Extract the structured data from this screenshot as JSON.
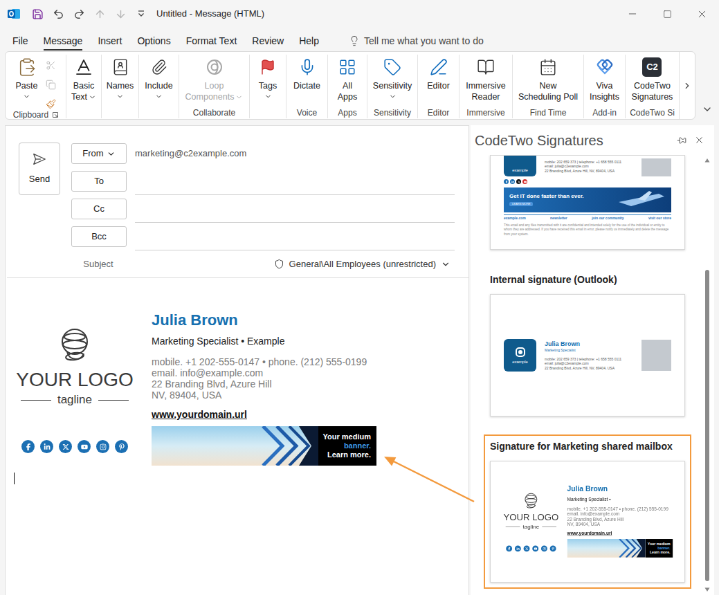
{
  "window": {
    "title": "Untitled - Message (HTML)"
  },
  "quick_access": [
    {
      "disabled": false
    },
    {
      "disabled": false
    },
    {
      "disabled": false
    },
    {
      "disabled": true
    },
    {
      "disabled": true
    },
    {
      "disabled": false
    }
  ],
  "menu": {
    "tabs": [
      {
        "label": "File",
        "selected": false
      },
      {
        "label": "Message",
        "selected": true
      },
      {
        "label": "Insert",
        "selected": false
      },
      {
        "label": "Options",
        "selected": false
      },
      {
        "label": "Format Text",
        "selected": false
      },
      {
        "label": "Review",
        "selected": false
      },
      {
        "label": "Help",
        "selected": false
      }
    ],
    "tell_me": {
      "placeholder": "Tell me what you want to do"
    }
  },
  "ribbon": {
    "groups": [
      {
        "label": "Clipboard",
        "buttons": [
          {
            "lines": [
              "Paste"
            ],
            "dropdown": true,
            "disabled": false
          }
        ],
        "tools": [
          {
            "disabled": true
          },
          {
            "disabled": true
          },
          {
            "disabled": false
          }
        ]
      },
      {
        "buttons": [
          {
            "lines": [
              "Basic",
              "Text"
            ],
            "dropdown": true,
            "disabled": false
          }
        ]
      },
      {
        "buttons": [
          {
            "lines": [
              "Names"
            ],
            "dropdown": true,
            "disabled": false
          }
        ]
      },
      {
        "buttons": [
          {
            "lines": [
              "Include"
            ],
            "dropdown": true,
            "disabled": false
          }
        ]
      },
      {
        "label": "Collaborate",
        "buttons": [
          {
            "lines": [
              "Loop",
              "Components"
            ],
            "dropdown": true,
            "disabled": true
          }
        ]
      },
      {
        "buttons": [
          {
            "lines": [
              "Tags"
            ],
            "dropdown": true,
            "disabled": false
          }
        ]
      },
      {
        "label": "Voice",
        "buttons": [
          {
            "lines": [
              "Dictate"
            ],
            "dropdown": false,
            "disabled": false
          }
        ]
      },
      {
        "label": "Apps",
        "buttons": [
          {
            "lines": [
              "All",
              "Apps"
            ],
            "dropdown": false,
            "disabled": false
          }
        ]
      },
      {
        "label": "Sensitivity",
        "buttons": [
          {
            "lines": [
              "Sensitivity"
            ],
            "dropdown": true,
            "disabled": false
          }
        ]
      },
      {
        "label": "Editor",
        "buttons": [
          {
            "lines": [
              "Editor"
            ],
            "dropdown": false,
            "disabled": false
          }
        ]
      },
      {
        "label": "Immersive",
        "buttons": [
          {
            "lines": [
              "Immersive",
              "Reader"
            ],
            "dropdown": false,
            "disabled": false
          }
        ]
      },
      {
        "label": "Find Time",
        "buttons": [
          {
            "lines": [
              "New",
              "Scheduling Poll"
            ],
            "dropdown": false,
            "disabled": false
          }
        ]
      },
      {
        "label": "Add-in",
        "buttons": [
          {
            "lines": [
              "Viva",
              "Insights"
            ],
            "dropdown": false,
            "disabled": false
          }
        ]
      },
      {
        "label": "CodeTwo Si",
        "buttons": [
          {
            "lines": [
              "CodeTwo",
              "Signatures"
            ],
            "dropdown": false,
            "disabled": false,
            "icon_text": "C2"
          }
        ]
      }
    ]
  },
  "compose": {
    "send": {
      "label": "Send"
    },
    "fields": [
      {
        "kind": "sender",
        "label": "From",
        "dropdown": true,
        "value": "marketing@c2example.com"
      },
      {
        "kind": "recipient",
        "label": "To",
        "dropdown": false,
        "value": ""
      },
      {
        "kind": "recipient",
        "label": "Cc",
        "dropdown": false,
        "value": ""
      },
      {
        "kind": "recipient",
        "label": "Bcc",
        "dropdown": false,
        "value": ""
      }
    ],
    "subject": {
      "label": "Subject",
      "value": ""
    },
    "sensitivity": {
      "label": "General\\All Employees (unrestricted)"
    }
  },
  "signature": {
    "logo": {
      "text": "YOUR LOGO",
      "tagline": "tagline"
    },
    "name": "Julia Brown",
    "title": "Marketing Specialist • Example",
    "contacts": [
      "mobile. +1 202-555-0147 • phone. (212) 555-0199",
      "email. info@example.com",
      "22 Branding Blvd, Azure Hill",
      "NV, 89404, USA"
    ],
    "website": "www.yourdomain.url",
    "banner": [
      {
        "text": "Your medium",
        "accent": false
      },
      {
        "text": "banner.",
        "accent": true
      },
      {
        "text": "Learn more.",
        "accent": false
      }
    ]
  },
  "pane": {
    "title": "CodeTwo Signatures",
    "templates": [
      {
        "kind": "full",
        "selected": false,
        "logo_text": "example",
        "contacts": [
          "mobile: 202 659 373 | telephone: +1 658 555 0111",
          "email: julia@c2example.com",
          "22 Branding Blvd, Azure Hill, NV, 89404, USA"
        ],
        "banner": {
          "text": "Get IT done faster than ever.",
          "button": "LEARN MORE"
        },
        "links": [
          "example.com",
          "newsletter",
          "join our community",
          "visit our store"
        ],
        "disclaimer": "This email and any files transmitted with it are confidential and intended solely for the use of the individual or entity to whom they are addressed. If you have received this email in error, please notify us immediately and delete the message from your system."
      },
      {
        "kind": "internal",
        "label": "Internal signature (Outlook)",
        "selected": false,
        "logo_text": "example",
        "name": "Julia Brown",
        "title": "Marketing Specialist",
        "contacts": [
          "mobile: 202 659 373 | telephone: +1 658 555 0111",
          "email: julia@c2example.com",
          "22 Branding Blvd, Azure Hill, NV, 89404, USA"
        ]
      },
      {
        "kind": "marketing",
        "label": "Signature for Marketing shared mailbox",
        "selected": true,
        "signature": {
          "logo": {
            "text": "YOUR LOGO",
            "tagline": "tagline"
          },
          "name": "Julia Brown",
          "title": "Marketing Specialist •",
          "contacts": [
            "mobile. +1 202-555-0147 • phone. (212) 555-0199",
            "email. info@example.com",
            "22 Branding Blvd, Azure Hill",
            "NV, 89404, USA"
          ],
          "website": "www.yourdomain.url",
          "banner": [
            {
              "text": "Your medium",
              "accent": false
            },
            {
              "text": "banner.",
              "accent": true
            },
            {
              "text": "Learn more.",
              "accent": false
            }
          ]
        }
      }
    ]
  }
}
